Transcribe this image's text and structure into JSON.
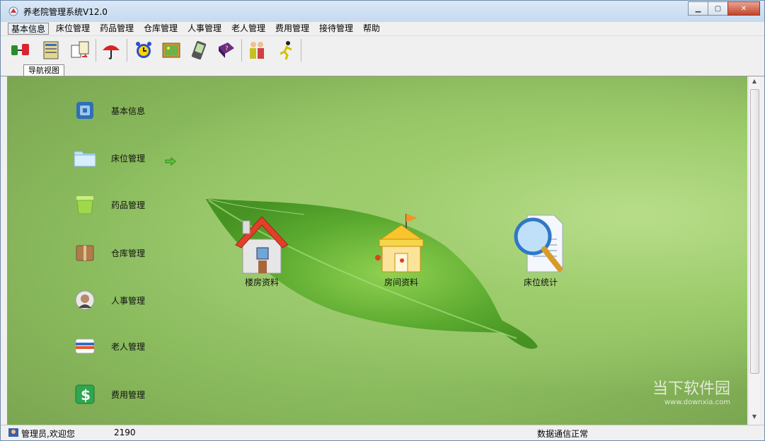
{
  "window": {
    "title": "养老院管理系统V12.0"
  },
  "menu": [
    "基本信息",
    "床位管理",
    "药品管理",
    "仓库管理",
    "人事管理",
    "老人管理",
    "费用管理",
    "接待管理",
    "帮助"
  ],
  "tab_label": "导航视图",
  "nav": [
    {
      "label": "基本信息",
      "icon": "info-cabinet-icon"
    },
    {
      "label": "床位管理",
      "icon": "folder-icon"
    },
    {
      "label": "药品管理",
      "icon": "green-box-icon"
    },
    {
      "label": "仓库管理",
      "icon": "package-icon"
    },
    {
      "label": "人事管理",
      "icon": "person-photo-icon"
    },
    {
      "label": "老人管理",
      "icon": "card-icon"
    },
    {
      "label": "费用管理",
      "icon": "dollar-icon"
    }
  ],
  "features": [
    {
      "label": "楼房资料",
      "icon": "house-icon"
    },
    {
      "label": "房间资料",
      "icon": "shop-building-icon"
    },
    {
      "label": "床位统计",
      "icon": "magnifier-document-icon"
    }
  ],
  "status": {
    "user": "管理员,欢迎您",
    "code": "2190",
    "comm": "数据通信正常"
  },
  "watermark": {
    "text": "当下软件园",
    "url": "www.downxia.com"
  },
  "colors": {
    "accent": "#8bbc5e",
    "leaf": "#5fae2a"
  }
}
